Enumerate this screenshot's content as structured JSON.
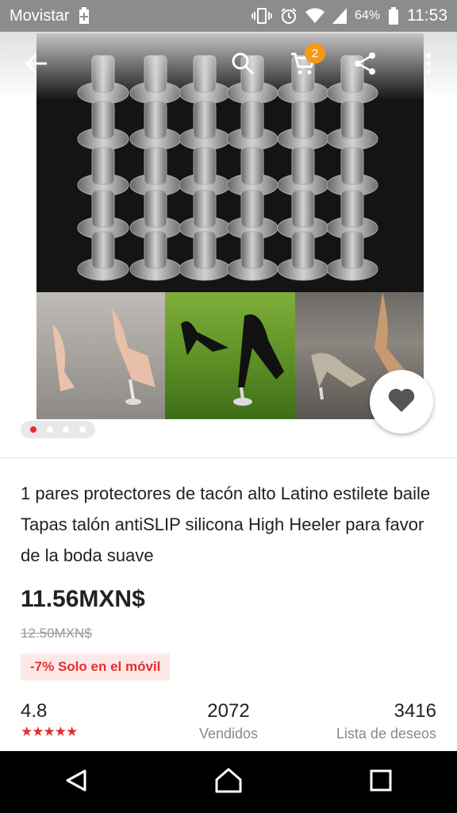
{
  "status_bar": {
    "carrier": "Movistar",
    "battery_percent": "64%",
    "time": "11:53"
  },
  "toolbar": {
    "cart_count": "2"
  },
  "gallery": {
    "slide_count": 4,
    "active_index": 0
  },
  "product": {
    "title": "1 pares protectores de tacón alto Latino estilete baile Tapas talón antiSLIP silicona High Heeler para favor de la boda suave",
    "price": "11.56MXN$",
    "original_price": "12.50MXN$",
    "promo": "-7% Solo en el móvil"
  },
  "stats": {
    "rating": "4.8",
    "stars": "★★★★★",
    "sold_count": "2072",
    "sold_label": "Vendidos",
    "wishlist_count": "3416",
    "wishlist_label": "Lista de deseos"
  },
  "colors": {
    "accent_red": "#e62e2e",
    "badge_orange": "#f39a19",
    "status_bar_gray": "#8c8c8c"
  }
}
